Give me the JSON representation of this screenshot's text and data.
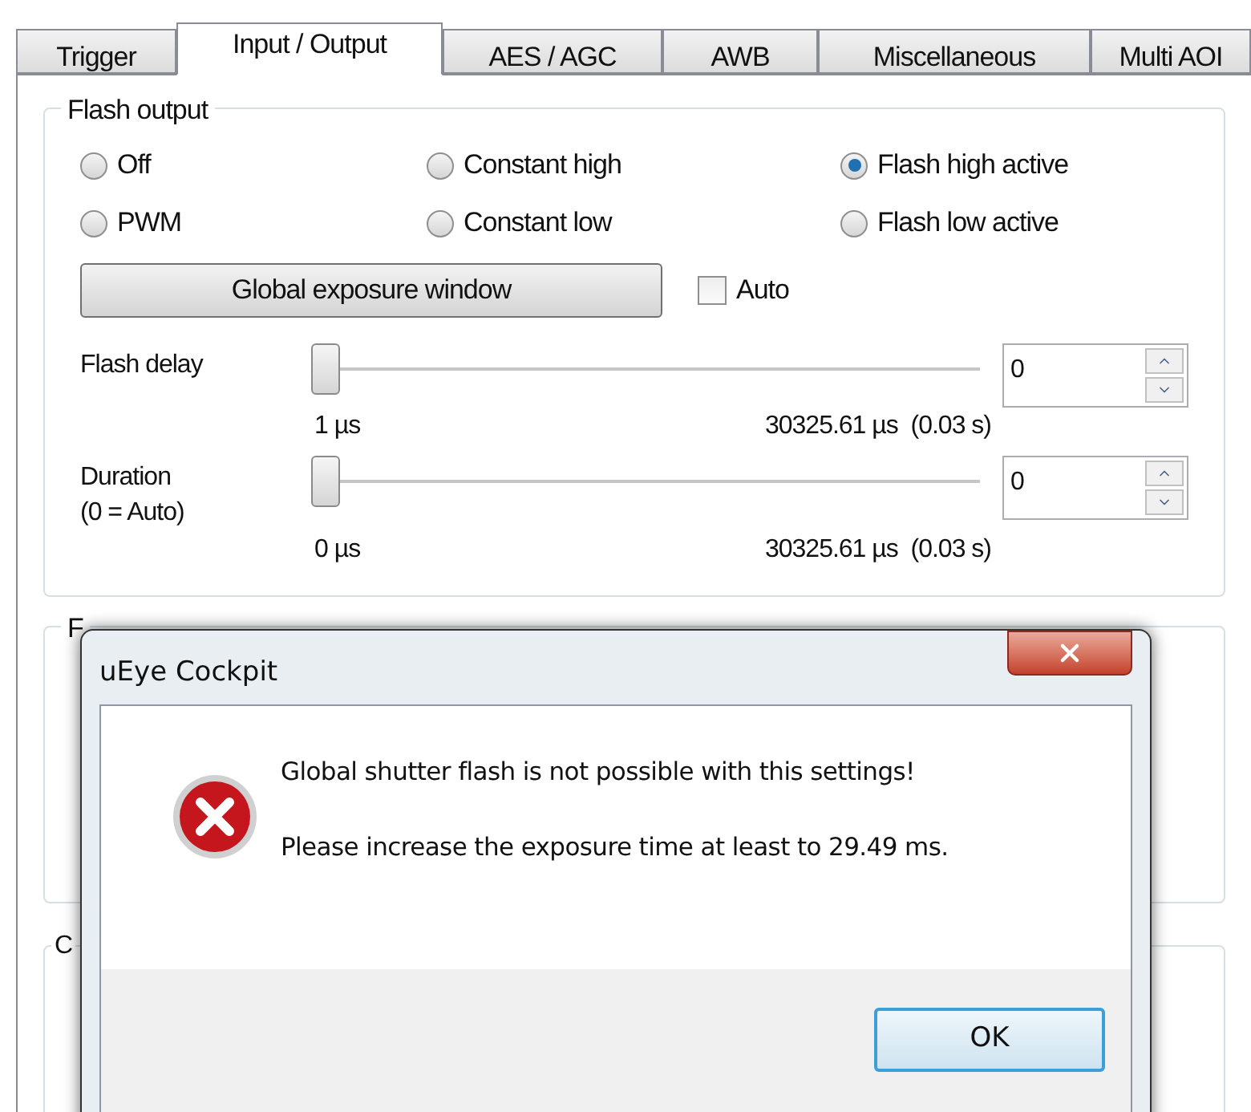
{
  "tabs": [
    {
      "label": "Trigger",
      "selected": false
    },
    {
      "label": "Input / Output",
      "selected": true
    },
    {
      "label": "AES / AGC",
      "selected": false
    },
    {
      "label": "AWB",
      "selected": false
    },
    {
      "label": "Miscellaneous",
      "selected": false
    },
    {
      "label": "Multi AOI",
      "selected": false
    }
  ],
  "flash_output": {
    "title": "Flash output",
    "modes": [
      {
        "label": "Off",
        "selected": false
      },
      {
        "label": "Constant high",
        "selected": false
      },
      {
        "label": "Flash high active",
        "selected": true
      },
      {
        "label": "PWM",
        "selected": false
      },
      {
        "label": "Constant low",
        "selected": false
      },
      {
        "label": "Flash low active",
        "selected": false
      }
    ],
    "global_button": "Global exposure window",
    "auto": {
      "label": "Auto",
      "checked": false
    },
    "sliders": [
      {
        "label": "Flash delay",
        "level": 0,
        "value": "0",
        "min_label": "1 µs",
        "max_label": "30325.61 µs  (0.03 s)"
      },
      {
        "label": "Duration\n(0 = Auto)",
        "level": 0,
        "value": "0",
        "min_label": "0 µs",
        "max_label": "30325.61 µs  (0.03 s)"
      }
    ]
  },
  "group_2": {
    "title": "F"
  },
  "group_3": {
    "title": "C"
  },
  "dialog": {
    "title": "uEye Cockpit",
    "message": "Global shutter flash is not possible with this settings!",
    "detail": "Please increase the exposure time at least to 29.49 ms.",
    "ok": "OK"
  }
}
